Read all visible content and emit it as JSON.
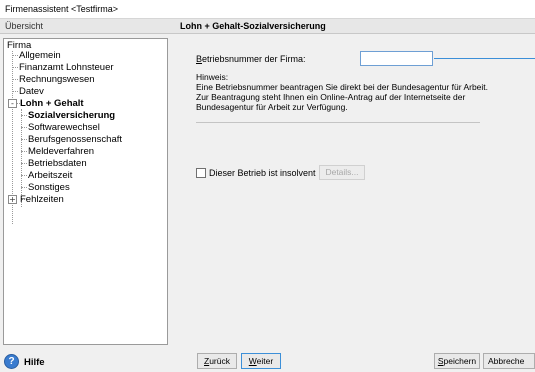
{
  "window": {
    "title": "Firmenassistent <Testfirma>"
  },
  "sidebar": {
    "header": "Übersicht",
    "tree": [
      {
        "label": "Firma"
      },
      {
        "label": "Allgemein"
      },
      {
        "label": "Finanzamt Lohnsteuer"
      },
      {
        "label": "Rechnungswesen"
      },
      {
        "label": "Datev"
      },
      {
        "label": "Lohn + Gehalt",
        "expander": "-"
      },
      {
        "label": "Sozialversicherung",
        "selected": true
      },
      {
        "label": "Softwarewechsel"
      },
      {
        "label": "Berufsgenossenschaft"
      },
      {
        "label": "Meldeverfahren"
      },
      {
        "label": "Betriebsdaten"
      },
      {
        "label": "Arbeitszeit"
      },
      {
        "label": "Sonstiges"
      },
      {
        "label": "Fehlzeiten",
        "expander": "+"
      }
    ]
  },
  "content": {
    "header": "Lohn + Gehalt-Sozialversicherung",
    "field_label_first": "B",
    "field_label_rest": "etriebsnummer der Firma:",
    "field_value": "",
    "hint_title": "Hinweis:",
    "hint_line1": "Eine Betriebsnummer beantragen Sie direkt bei der Bundesagentur für Arbeit.",
    "hint_line2": "Zur Beantragung steht Ihnen ein Online-Antrag auf der Internetseite der",
    "hint_line3": "Bundesagentur für Arbeit zur Verfügung.",
    "insolvent_label": "Dieser Betrieb ist insolvent",
    "details_button": "Details..."
  },
  "footer": {
    "help_label": "Hilfe",
    "back_first": "Z",
    "back_rest": "urück",
    "next_first": "W",
    "next_rest": "eiter",
    "save_first": "S",
    "save_rest": "peichern",
    "cancel_label": "Abbreche"
  },
  "colors": {
    "accent": "#3c8fd8",
    "help_icon": "#3a7ccf"
  }
}
